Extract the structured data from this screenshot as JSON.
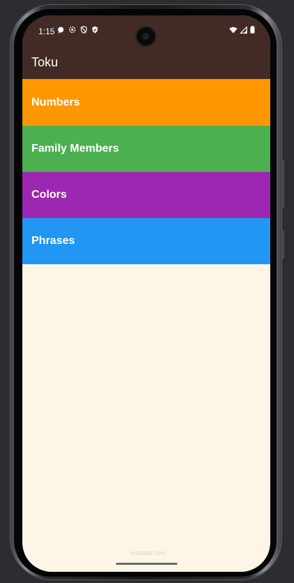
{
  "status_bar": {
    "time": "1:15",
    "left_icons": [
      "chat-bubble-icon",
      "settings-gear-icon",
      "shield-slash-icon",
      "shield-check-icon"
    ],
    "right_icons": [
      "wifi-icon",
      "cellular-signal-icon",
      "battery-icon"
    ]
  },
  "app_bar": {
    "title": "Toku",
    "background_color": "#422a25"
  },
  "categories": [
    {
      "label": "Numbers",
      "color": "#ff9800"
    },
    {
      "label": "Family Members",
      "color": "#4caf50"
    },
    {
      "label": "Colors",
      "color": "#9c27b0"
    },
    {
      "label": "Phrases",
      "color": "#2196f3"
    }
  ],
  "body_background": "#fdf6e7",
  "watermark": "mostaql.com"
}
